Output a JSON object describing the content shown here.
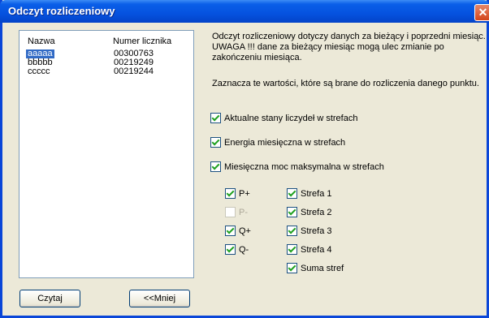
{
  "window": {
    "title": "Odczyt rozliczeniowy",
    "close_symbol": "✕"
  },
  "list": {
    "columns": [
      "Nazwa",
      "Numer licznika"
    ],
    "rows": [
      {
        "name": "aaaaa",
        "number": "00300763",
        "selected": true
      },
      {
        "name": "bbbbb",
        "number": "00219249",
        "selected": false
      },
      {
        "name": "ccccc",
        "number": "00219244",
        "selected": false
      }
    ]
  },
  "buttons": {
    "read_label": "Czytaj",
    "less_label": "<<Mniej"
  },
  "info": {
    "paragraph1": "Odczyt rozliczeniowy dotyczy danych za bieżący i poprzedni miesiąc. UWAGA !!! dane za bieżący miesiąc mogą ulec zmianie po zakończeniu miesiąca.",
    "paragraph2": "Zaznacza te wartości, które są brane do rozliczenia danego punktu."
  },
  "options": {
    "current_states": {
      "label": "Aktualne stany liczydeł w strefach",
      "checked": true
    },
    "monthly_energy": {
      "label": "Energia miesięczna w strefach",
      "checked": true
    },
    "monthly_power": {
      "label": "Miesięczna moc maksymalna w strefach",
      "checked": true
    }
  },
  "energies": [
    {
      "label": "P+",
      "checked": true,
      "enabled": true
    },
    {
      "label": "P-",
      "checked": false,
      "enabled": false
    },
    {
      "label": "Q+",
      "checked": true,
      "enabled": true
    },
    {
      "label": "Q-",
      "checked": true,
      "enabled": true
    }
  ],
  "zones": [
    {
      "label": "Strefa 1",
      "checked": true
    },
    {
      "label": "Strefa 2",
      "checked": true
    },
    {
      "label": "Strefa 3",
      "checked": true
    },
    {
      "label": "Strefa 4",
      "checked": true
    },
    {
      "label": "Suma stref",
      "checked": true
    }
  ]
}
